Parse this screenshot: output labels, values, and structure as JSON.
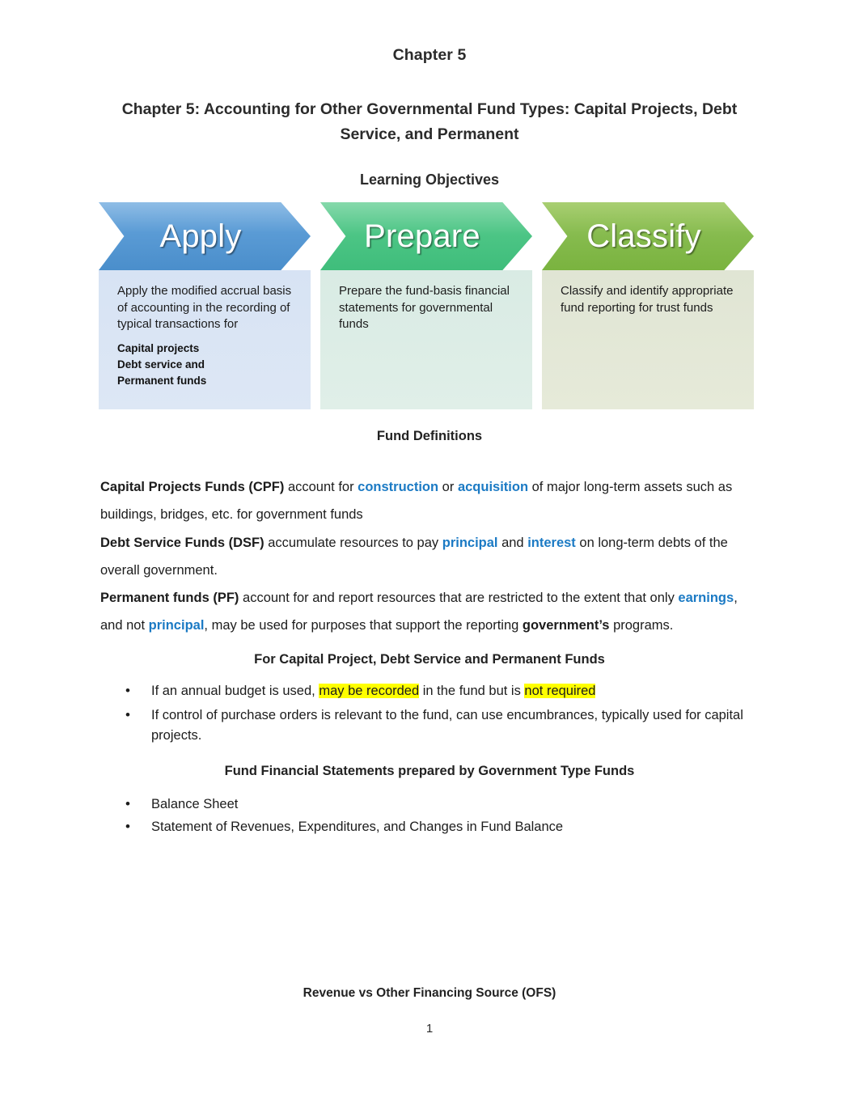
{
  "document": {
    "header": "Chapter 5",
    "title": "Chapter 5: Accounting for Other Governmental Fund Types: Capital Projects, Debt Service, and Permanent",
    "page_number": "1"
  },
  "learning_objectives": {
    "heading": "Learning Objectives",
    "columns": [
      {
        "chevron_label": "Apply",
        "chevron_color": "#5a9bd5",
        "panel_color": "#d7e3f4",
        "body": "Apply the modified accrual basis of accounting in the recording of typical transactions for",
        "sub_items": [
          "Capital projects",
          "Debt service and",
          "Permanent funds"
        ]
      },
      {
        "chevron_label": "Prepare",
        "chevron_color": "#4cc585",
        "panel_color": "#d9ebe4",
        "body": "Prepare the fund-basis financial statements for governmental funds",
        "sub_items": []
      },
      {
        "chevron_label": "Classify",
        "chevron_color": "#86bb4e",
        "panel_color": "#e0e5d4",
        "body": "Classify and identify appropriate fund reporting for trust funds",
        "sub_items": []
      }
    ]
  },
  "fund_definitions": {
    "heading": "Fund Definitions",
    "cpf": {
      "term": "Capital Projects Funds (CPF)",
      "text_1": " account for ",
      "accent_1": "construction",
      "text_2": " or ",
      "accent_2": "acquisition",
      "text_3": " of major long-term assets such as buildings, bridges, etc. for government funds"
    },
    "dsf": {
      "term": "Debt Service Funds (DSF)",
      "text_1": " accumulate resources to pay ",
      "accent_1": "principal",
      "text_2": " and ",
      "accent_2": "interest",
      "text_3": " on long-term debts of the overall government."
    },
    "pf": {
      "term": "Permanent funds (PF)",
      "text_1": " account for and report resources that are restricted to the extent that only ",
      "accent_1": "earnings",
      "text_2": ", and not ",
      "accent_2": "principal",
      "text_3": ", may be used for purposes that support the reporting ",
      "bold_1": "government’s",
      "text_4": " programs."
    }
  },
  "for_funds": {
    "heading": "For Capital Project, Debt Service and Permanent Funds",
    "bullet_1": {
      "text_1": "If an annual budget is used, ",
      "highlight_1": "may be recorded",
      "text_2": " in the fund but is ",
      "highlight_2": "not required"
    },
    "bullet_2": "If control of purchase orders is relevant to the fund, can use encumbrances, typically used for capital projects."
  },
  "fund_financial_statements": {
    "heading": "Fund Financial Statements prepared by Government Type Funds",
    "items": [
      "Balance Sheet",
      "Statement of Revenues, Expenditures, and Changes in Fund Balance"
    ]
  },
  "revenue_section": {
    "heading": "Revenue vs Other Financing Source (OFS)"
  }
}
